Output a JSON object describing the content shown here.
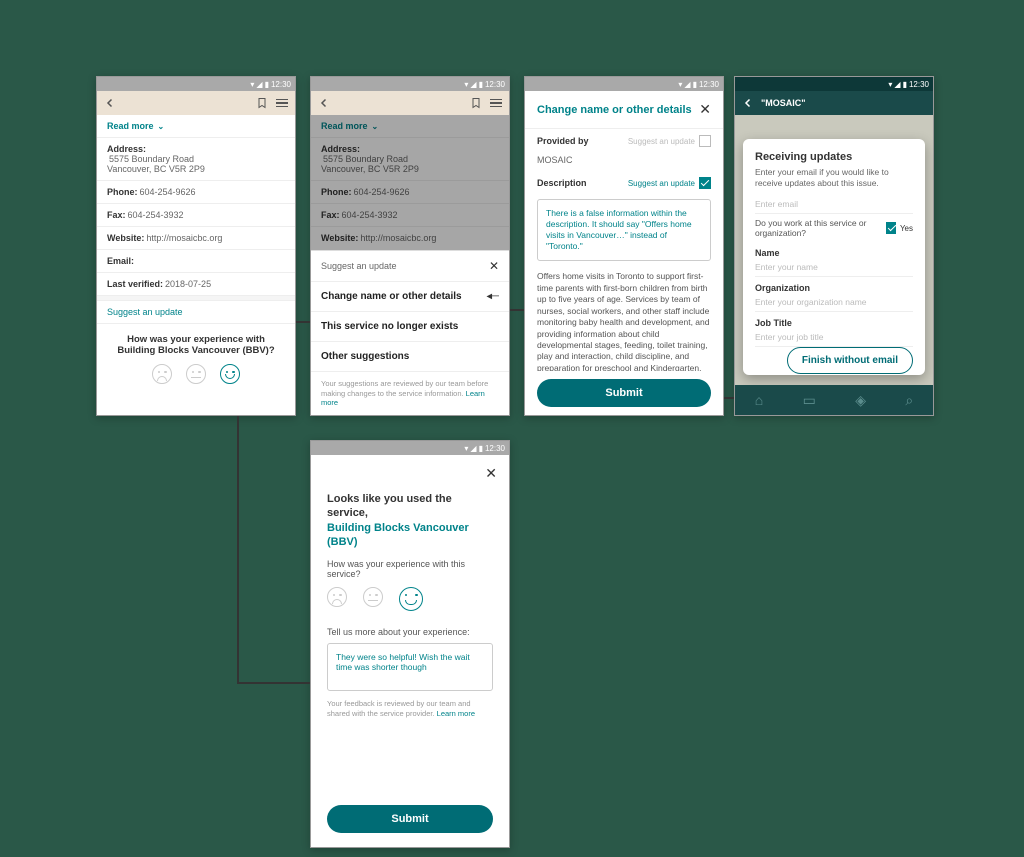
{
  "status": {
    "time": "12:30"
  },
  "screen1": {
    "readmore": "Read more",
    "address_label": "Address:",
    "address_value": "5575 Boundary Road\nVancouver, BC V5R 2P9",
    "phone_label": "Phone:",
    "phone_value": "604-254-9626",
    "fax_label": "Fax:",
    "fax_value": "604-254-3932",
    "website_label": "Website:",
    "website_value": "http://mosaicbc.org",
    "email_label": "Email:",
    "lastverified_label": "Last verified:",
    "lastverified_value": "2018-07-25",
    "suggest": "Suggest an update",
    "question": "How was your experience with Building Blocks Vancouver (BBV)?"
  },
  "screen2": {
    "sheet_title": "Suggest an update",
    "item1": "Change name or other details",
    "item2": "This service no longer exists",
    "item3": "Other suggestions",
    "note": "Your suggestions are reviewed by our team before making changes to the service information.",
    "learnmore": "Learn more"
  },
  "screen3": {
    "title": "Change name or other details",
    "provided_label": "Provided by",
    "provided_value": "MOSAIC",
    "suggest_off": "Suggest an update",
    "desc_label": "Description",
    "suggest_on": "Suggest an update",
    "correction": "There is a false information within the description. It should say \"Offers home visits in Vancouver…\" instead of \"Toronto.\"",
    "body": "Offers home visits in Toronto to support first-time parents with first-born children from birth up to five years of age. Services by team of nurses, social workers, and other staff include monitoring baby health and development, and providing information about child developmental stages, feeding, toilet training, play and interaction, child discipline, and preparation for preschool and Kindergarten. Service offered in Cantonese, English, Hindi, Korean, Mandarin, Punjabi, Spanish, Tagalog, Tamil, Urdu, and Vietnamese.",
    "submit": "Submit"
  },
  "screen4": {
    "breadcrumb": "\"MOSAIC\"",
    "title": "Receiving updates",
    "intro": "Enter your email if you would like to receive updates about this issue.",
    "email_ph": "Enter email",
    "work_q": "Do you work at this service or organization?",
    "yes": "Yes",
    "name_label": "Name",
    "name_ph": "Enter your name",
    "org_label": "Organization",
    "org_ph": "Enter your organization name",
    "job_label": "Job Title",
    "job_ph": "Enter your job title",
    "finish": "Finish without email"
  },
  "screen5": {
    "title_prefix": "Looks like you used the service,",
    "title_hl": "Building Blocks Vancouver (BBV)",
    "q": "How was your experience with this service?",
    "tell": "Tell us more about your experience:",
    "feedback": "They were so helpful! Wish the wait time was shorter though",
    "note": "Your feedback is reviewed by our team and shared with the service provider.",
    "learnmore": "Learn more",
    "submit": "Submit"
  }
}
